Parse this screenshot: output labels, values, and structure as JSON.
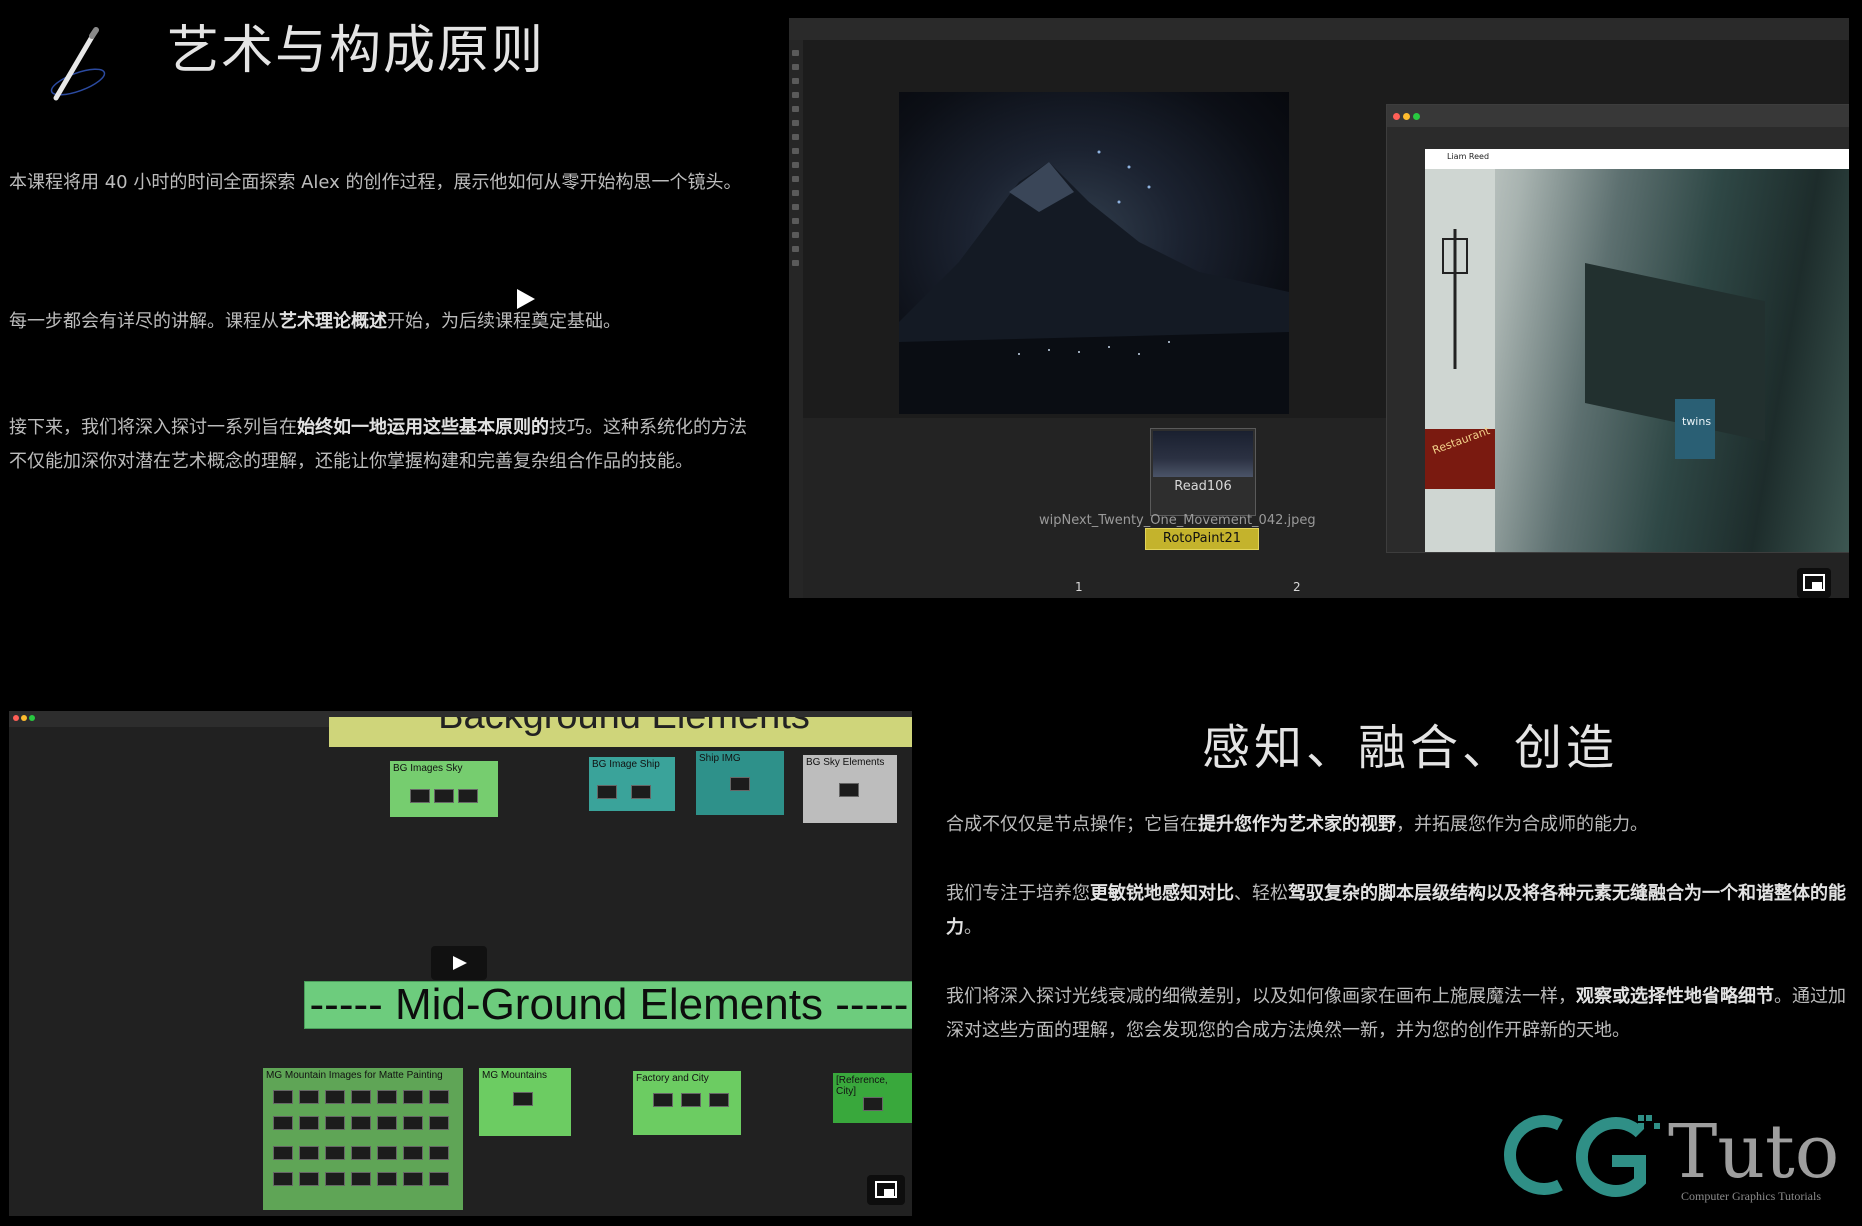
{
  "section1": {
    "title": "艺术与构成原则",
    "p1": "本课程将用 40 小时的时间全面探索 Alex 的创作过程，展示他如何从零开始构思一个镜头。",
    "p2_parts": [
      "每一步都会有详尽的讲解。课程从",
      "艺术理论概述",
      "开始，为后续课程奠定基础。"
    ],
    "p3_parts": [
      "接下来，我们将深入探讨一系列旨在",
      "始终如一地运用这些基本原则的",
      "技巧。这种系统化的方法不仅能加深你对潜在艺术概念的理解，还能让你掌握构建和完善复杂组合作品的技能。"
    ]
  },
  "video1": {
    "read_node_label": "Read106",
    "read_node_file": "wipNext_Twenty_One_Movement_042.jpeg",
    "roto_node_label": "RotoPaint21",
    "browser_post_author": "Liam Reed",
    "photo_sign": "Restaurant",
    "photo_sign2": "twins",
    "pin1": "1",
    "pin2": "2"
  },
  "section2": {
    "title": "感知、融合、创造",
    "q1_parts": [
      "合成不仅仅是节点操作；它旨在",
      "提升您作为艺术家的视野",
      "，并拓展您作为合成师的能力。"
    ],
    "q2_parts": [
      "我们专注于培养您",
      "更敏锐地感知对比",
      "、轻松",
      "驾驭复杂的脚本层级结构以及将各种元素无缝融合为一个和谐整体的能力",
      "。"
    ],
    "q3_parts": [
      "我们将深入探讨光线衰减的细微差别，以及如何像画家在画布上施展魔法一样，",
      "观察或选择性地省略细节",
      "。通过加深对这些方面的理解，您会发现您的合成方法焕然一新，并为您的创作开辟新的天地。"
    ]
  },
  "video2": {
    "bg_header": "Background Elements",
    "bg_boxes": [
      "BG Images Sky",
      "BG Image Ship",
      "Ship IMG",
      "BG Sky Elements"
    ],
    "mid_band": "----- Mid-Ground Elements -----",
    "mg_boxes": [
      "MG Mountain Images for Matte Painting",
      "MG Mountains",
      "Factory and City",
      "[Reference, City]"
    ]
  },
  "logo": {
    "name": "Tuto",
    "tagline": "Computer Graphics Tutorials"
  },
  "colors": {
    "bg": "#000000",
    "text": "#bcbcbc",
    "bold_text": "#e2e2e2",
    "node_green": "#6dcc7d",
    "roto_yellow": "#c4b32c",
    "logo_teal": "#2f8f86"
  }
}
